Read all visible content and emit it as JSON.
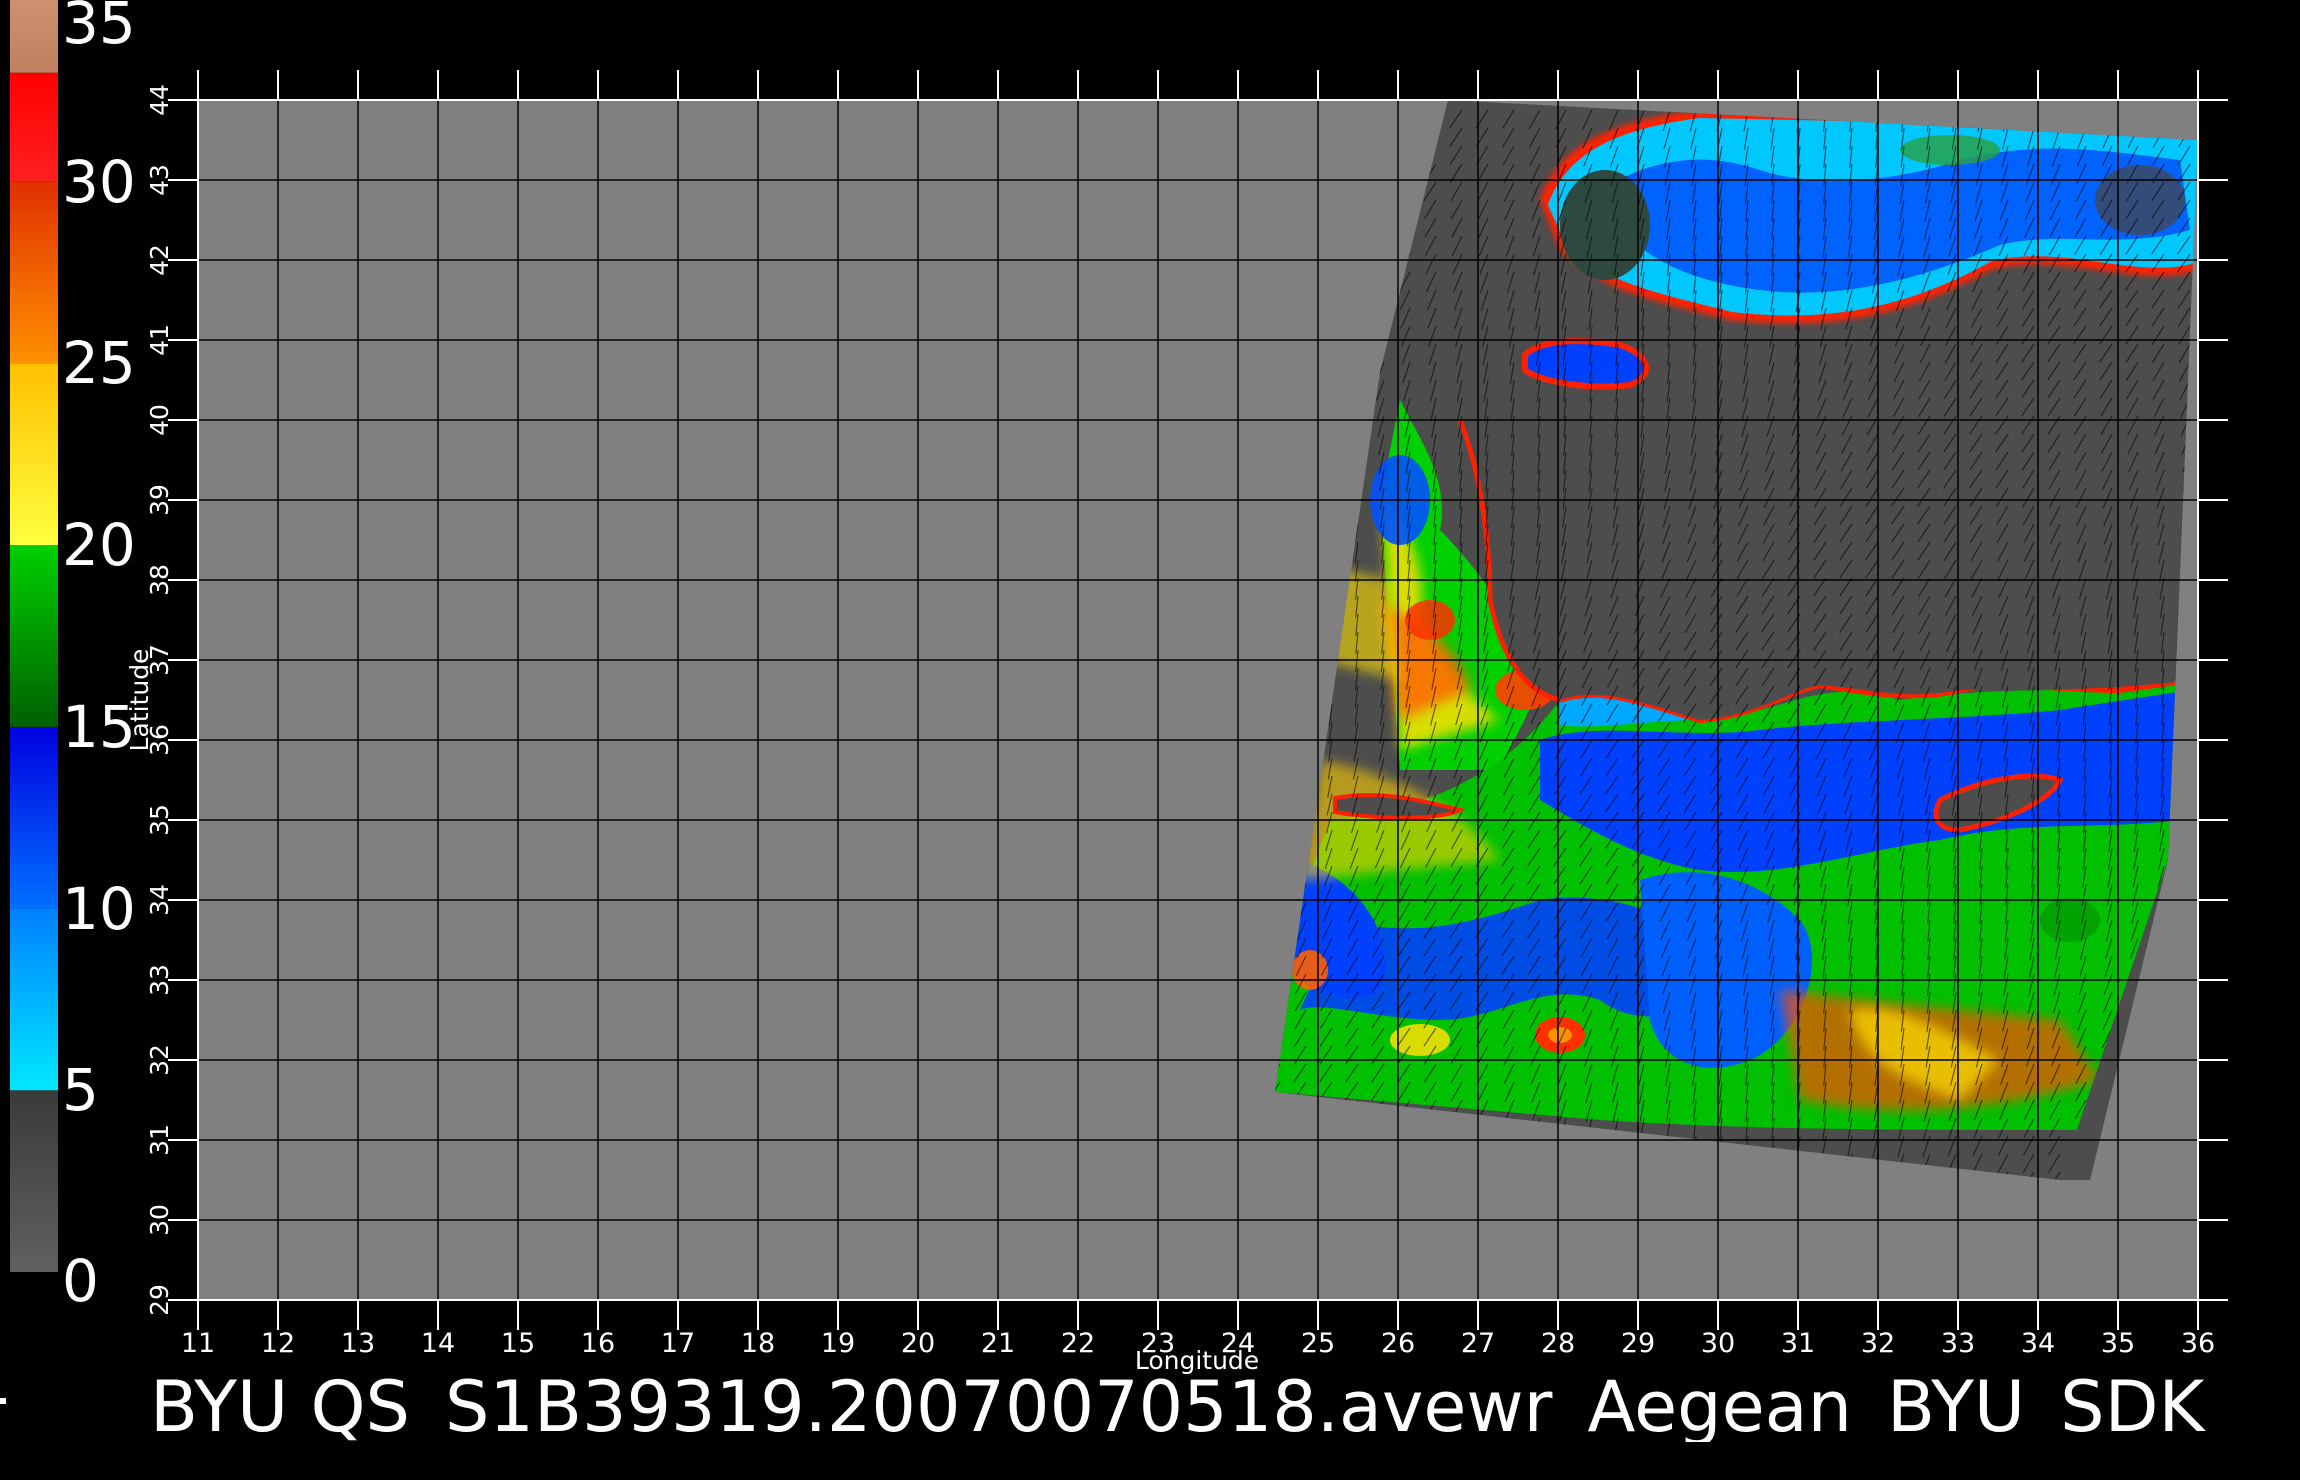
{
  "colors": {
    "land": "#808080",
    "no_data": "#4d4d4d",
    "background": "#000000",
    "grid": "#000000",
    "text": "#ffffff"
  },
  "map": {
    "lon_ticks": [
      "11",
      "12",
      "13",
      "14",
      "15",
      "16",
      "17",
      "18",
      "19",
      "20",
      "21",
      "22",
      "23",
      "24",
      "25",
      "26",
      "27",
      "28",
      "29",
      "30",
      "31",
      "32",
      "33",
      "34",
      "35",
      "36"
    ],
    "lat_ticks": [
      "29",
      "30",
      "31",
      "32",
      "33",
      "34",
      "35",
      "36",
      "37",
      "38",
      "39",
      "40",
      "41",
      "42",
      "43",
      "44"
    ],
    "xlabel": "Longitude",
    "ylabel": "Latitude",
    "lon_range": [
      11,
      36
    ],
    "lat_range": [
      29,
      44
    ]
  },
  "colorbar": {
    "labels": [
      "35",
      "30",
      "25",
      "20",
      "15",
      "10",
      "5",
      "0"
    ],
    "range": [
      0,
      35
    ],
    "stops": [
      {
        "from": 0,
        "to": 5,
        "color": "#606060",
        "color2": "#3a3a3a"
      },
      {
        "from": 5,
        "to": 10,
        "color": "#00e8ff",
        "color2": "#0080ff"
      },
      {
        "from": 10,
        "to": 15,
        "color": "#0070ff",
        "color2": "#0000e0"
      },
      {
        "from": 15,
        "to": 20,
        "color": "#006000",
        "color2": "#00d000"
      },
      {
        "from": 20,
        "to": 25,
        "color": "#ffff40",
        "color2": "#ffc000"
      },
      {
        "from": 25,
        "to": 30,
        "color": "#ff9000",
        "color2": "#e03000"
      },
      {
        "from": 30,
        "to": 33,
        "color": "#ff2020",
        "color2": "#ff0000"
      },
      {
        "from": 33,
        "to": 35,
        "color": "#c08060",
        "color2": "#d09070"
      }
    ]
  },
  "caption": {
    "text": "BYU  QS_S1B39319.20070070518.avewr_Aegean_BYU_SDK"
  }
}
